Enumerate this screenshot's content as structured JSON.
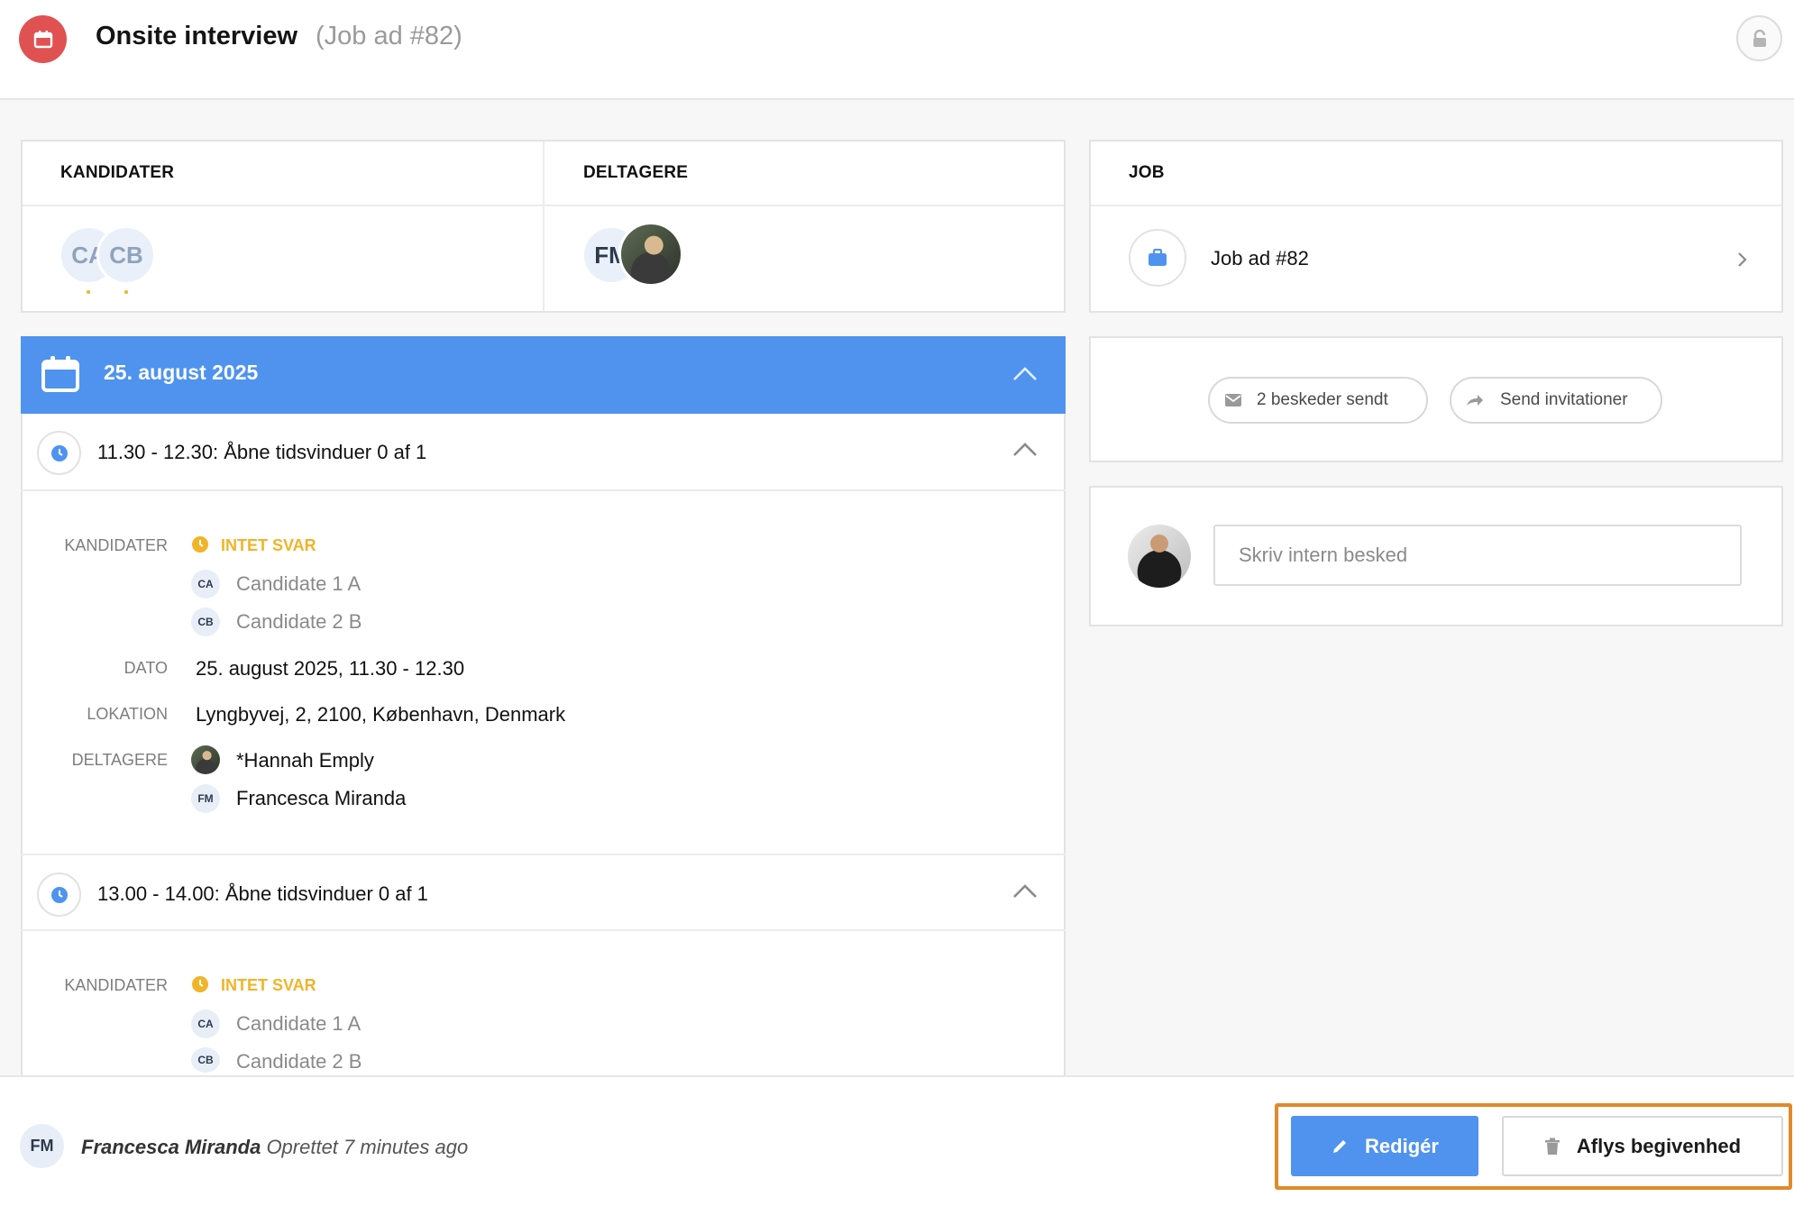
{
  "header": {
    "title": "Onsite interview",
    "subtitle": "(Job ad #82)",
    "app_icon": "calendar-icon",
    "lock_icon": "lock-icon"
  },
  "people_card": {
    "candidates_label": "KANDIDATER",
    "participants_label": "DELTAGERE",
    "candidate_avatars": [
      "CA",
      "CB"
    ],
    "participant_avatars": [
      "FM"
    ]
  },
  "job_card": {
    "label": "JOB",
    "job_name": "Job ad #82"
  },
  "date_section": {
    "date": "25. august 2025",
    "slots": [
      {
        "title": "11.30 - 12.30: Åbne tidsvinduer 0 af 1",
        "candidates_label": "KANDIDATER",
        "status": "INTET SVAR",
        "candidates": [
          {
            "initials": "CA",
            "name": "Candidate 1 A"
          },
          {
            "initials": "CB",
            "name": "Candidate 2 B"
          }
        ],
        "date_label": "DATO",
        "date_value": "25. august 2025, 11.30 - 12.30",
        "location_label": "LOKATION",
        "location_value": "Lyngbyvej, 2, 2100, København, Denmark",
        "participants_label": "DELTAGERE",
        "participants": [
          {
            "initials": "",
            "name": "*Hannah Emply"
          },
          {
            "initials": "FM",
            "name": "Francesca Miranda"
          }
        ]
      },
      {
        "title": "13.00 - 14.00: Åbne tidsvinduer 0 af 1",
        "candidates_label": "KANDIDATER",
        "status": "INTET SVAR",
        "candidates": [
          {
            "initials": "CA",
            "name": "Candidate 1 A"
          },
          {
            "initials": "CB",
            "name": "Candidate 2 B"
          }
        ]
      }
    ]
  },
  "messages_card": {
    "sent_label": "2 beskeder sendt",
    "send_label": "Send invitationer"
  },
  "note": {
    "placeholder": "Skriv intern besked"
  },
  "footer": {
    "initials": "FM",
    "author": "Francesca Miranda",
    "action": "Oprettet 7 minutes ago",
    "edit_label": "Redigér",
    "cancel_label": "Aflys begivenhed"
  },
  "colors": {
    "accent": "#4f93ef",
    "danger": "#e05252",
    "warning": "#f0b429",
    "highlight": "#e08a2a"
  }
}
